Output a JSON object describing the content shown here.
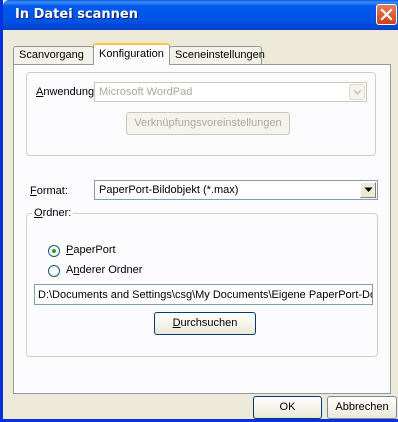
{
  "window": {
    "title": "In Datei scannen"
  },
  "tabs": [
    {
      "label": "Scanvorgang"
    },
    {
      "label": "Konfiguration"
    },
    {
      "label": "Sceneinstellungen"
    }
  ],
  "application_group": {
    "label": "Anwendung:",
    "value": "Microsoft WordPad",
    "settings_button": "Verknüpfungsvoreinstellungen"
  },
  "format": {
    "label": "Format:",
    "value": "PaperPort-Bildobjekt (*.max)"
  },
  "folder_group": {
    "label": "Ordner:",
    "option_paperport": "PaperPort",
    "option_other": "Anderer Ordner",
    "path": "D:\\Documents and Settings\\csg\\My Documents\\Eigene PaperPort-Dok",
    "browse_button": "Durchsuchen"
  },
  "footer": {
    "ok_button": "OK",
    "cancel_button": "Abbrechen"
  },
  "colors": {
    "titlebar": "#0054e3",
    "dialog_bg": "#ece9d8",
    "panel_bg": "#fcfcfe"
  }
}
